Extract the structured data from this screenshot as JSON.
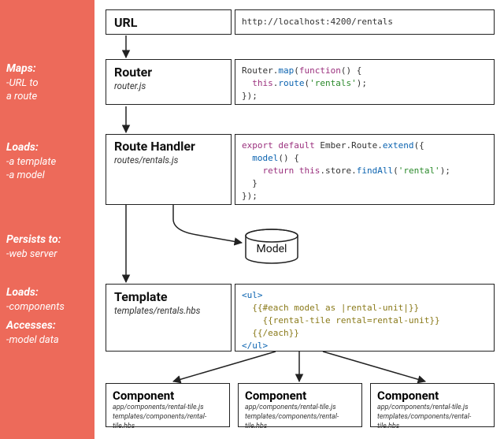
{
  "side": {
    "maps": {
      "title": "Maps:",
      "l1": "-URL to",
      "l2": "a route"
    },
    "loads1": {
      "title": "Loads:",
      "l1": "-a template",
      "l2": "-a model"
    },
    "persists": {
      "title": "Persists to:",
      "l1": "-web server"
    },
    "loads2": {
      "title": "Loads:",
      "l1": "-components"
    },
    "accesses": {
      "title": "Accesses:",
      "l1": "-model data"
    }
  },
  "url": {
    "title": "URL",
    "value": "http://localhost:4200/rentals"
  },
  "router": {
    "title": "Router",
    "sub": "router.js",
    "code": "Router.<span class='fn'>map</span>(<span class='kw'>function</span>() {\n  <span class='kw'>this</span>.<span class='fn'>route</span>(<span class='str'>'rentals'</span>);\n});"
  },
  "route": {
    "title": "Route Handler",
    "sub": "routes/rentals.js",
    "code": "<span class='kw'>export default</span> Ember.Route.<span class='fn'>extend</span>({\n  <span class='fn'>model</span>() {\n    <span class='kw'>return this</span>.store.<span class='fn'>findAll</span>(<span class='str'>'rental'</span>);\n  }\n});"
  },
  "model": {
    "label": "Model"
  },
  "template": {
    "title": "Template",
    "sub": "templates/rentals.hbs",
    "code": "<span class='tag'>&lt;ul&gt;</span>\n  <span class='hb'>{{#each model as |rental-unit|}}</span>\n    <span class='hb'>{{rental-tile rental=rental-unit}}</span>\n  <span class='hb'>{{/each}}</span>\n<span class='tag'>&lt;/ul&gt;</span>"
  },
  "component": {
    "title": "Component",
    "l1": "app/components/rental-tile.js",
    "l2": "templates/components/rental-tile.hbs"
  }
}
